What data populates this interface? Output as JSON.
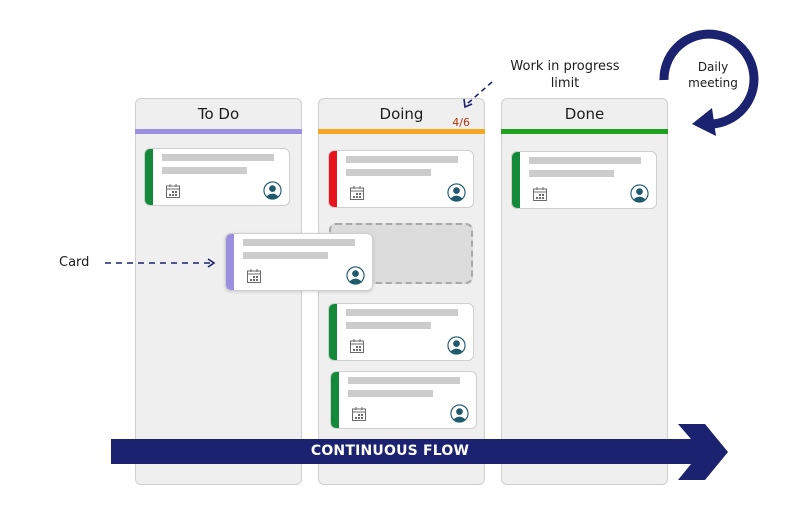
{
  "board": {
    "columns": [
      {
        "title": "To Do",
        "accent": "#9b8fe0"
      },
      {
        "title": "Doing",
        "accent": "#f5a623",
        "wip_limit": "4/6",
        "wip_color": "#b1360d"
      },
      {
        "title": "Done",
        "accent": "#1fa31f"
      }
    ],
    "cards": [
      {
        "column": "To Do",
        "stripe_color": "#128a3a",
        "icons": [
          "calendar-icon",
          "user-avatar-icon"
        ]
      },
      {
        "column": "To Do",
        "stripe_color": "#9b8fe0",
        "state": "being dragged",
        "icons": [
          "calendar-icon",
          "user-avatar-icon"
        ]
      },
      {
        "column": "Doing",
        "stripe_color": "#e8141c",
        "icons": [
          "calendar-icon",
          "user-avatar-icon"
        ]
      },
      {
        "column": "Doing",
        "stripe_color": "#128a3a",
        "icons": [
          "calendar-icon",
          "user-avatar-icon"
        ]
      },
      {
        "column": "Doing",
        "stripe_color": "#128a3a",
        "icons": [
          "calendar-icon",
          "user-avatar-icon"
        ]
      },
      {
        "column": "Done",
        "stripe_color": "#128a3a",
        "icons": [
          "calendar-icon",
          "user-avatar-icon"
        ]
      }
    ],
    "drop_placeholder": {
      "column": "Doing",
      "style": "dashed"
    }
  },
  "annotations": {
    "card_label": "Card",
    "wip_label_line1": "Work in progress",
    "wip_label_line2": "limit",
    "daily_line1": "Daily",
    "daily_line2": "meeting",
    "flow_label": "CONTINUOUS FLOW"
  },
  "colors": {
    "navy": "#1b2270",
    "avatar": "#1f5a6e",
    "column_bg": "#efefef"
  }
}
